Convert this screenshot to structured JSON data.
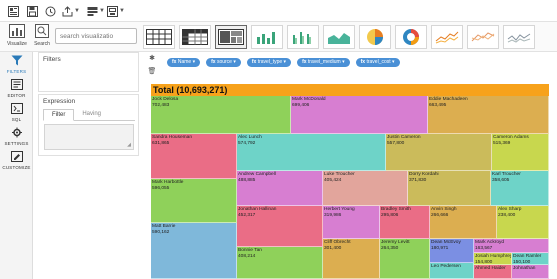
{
  "toolbar": {
    "icons": [
      "dashboard-icon",
      "save-icon",
      "history-icon",
      "export-icon",
      "layout-icon",
      "print-icon"
    ]
  },
  "left_controls": {
    "visualize_label": "Visualize",
    "search_label": "Search",
    "search_placeholder": "search visualizatio"
  },
  "gallery": {
    "items": [
      "table-grid",
      "pivot-table",
      "treemap",
      "bar-chart",
      "grouped-bar-chart",
      "area-chart",
      "pie-chart",
      "donut-chart",
      "line-chart",
      "multi-line-chart",
      "area-line-chart"
    ],
    "active": "treemap"
  },
  "rail": {
    "items": [
      {
        "label": "FILTERS",
        "icon": "filter-icon",
        "active": true
      },
      {
        "label": "EDITOR",
        "icon": "editor-icon",
        "active": false
      },
      {
        "label": "SQL",
        "icon": "sql-icon",
        "active": false
      },
      {
        "label": "SETTINGS",
        "icon": "settings-icon",
        "active": false
      },
      {
        "label": "CUSTOMIZE",
        "icon": "customize-icon",
        "active": false
      }
    ]
  },
  "filters_panel": {
    "title": "Filters"
  },
  "expression_panel": {
    "title": "Expression",
    "tabs": [
      "Filter",
      "Having"
    ],
    "active_tab": "Filter"
  },
  "pills": [
    {
      "prefix": "fx",
      "label": "Name"
    },
    {
      "prefix": "fx",
      "label": "source"
    },
    {
      "prefix": "fx",
      "label": "travel_type"
    },
    {
      "prefix": "fx",
      "label": "travel_medium"
    },
    {
      "prefix": "fx",
      "label": "travel_cost"
    }
  ],
  "treemap": {
    "total_label": "Total (10,693,271)",
    "total_color": "#f7a21b",
    "cells": [
      {
        "name": "Jock Delosa",
        "value": "702,483",
        "color": "#8fd15a"
      },
      {
        "name": "Mark McDonald",
        "value": "699,406",
        "color": "#d77ed1"
      },
      {
        "name": "Eddie Machadeen",
        "value": "663,495",
        "color": "#dcae50"
      },
      {
        "name": "Sandra Houseman",
        "value": "631,865",
        "color": "#ea6d86"
      },
      {
        "name": "Alec Lunch",
        "value": "574,792",
        "color": "#6ed3c8"
      },
      {
        "name": "Justin Cameron",
        "value": "557,800",
        "color": "#cbbb5b"
      },
      {
        "name": "Cameron Adams",
        "value": "515,369",
        "color": "#c8d74e"
      },
      {
        "name": "Mark Harbottle",
        "value": "596,055",
        "color": "#8fd15a"
      },
      {
        "name": "Andrew Campbell",
        "value": "488,885",
        "color": "#d77ed1"
      },
      {
        "name": "Luke Troucher",
        "value": "405,424",
        "color": "#e2a59c"
      },
      {
        "name": "Dorry Kordahi",
        "value": "371,830",
        "color": "#cbbb5b"
      },
      {
        "name": "Karl Troucher",
        "value": "358,605",
        "color": "#6ed3c8"
      },
      {
        "name": "Jonathan Hallinan",
        "value": "452,317",
        "color": "#ea6d86"
      },
      {
        "name": "Herbert Young",
        "value": "319,986",
        "color": "#d77ed1"
      },
      {
        "name": "Bradley Smith",
        "value": "295,806",
        "color": "#ea6d86"
      },
      {
        "name": "Anvin Singh",
        "value": "266,666",
        "color": "#dcae50"
      },
      {
        "name": "Alex Sharp",
        "value": "238,400",
        "color": "#c8d74e"
      },
      {
        "name": "Matt Barrie",
        "value": "590,162",
        "color": "#7fb8da"
      },
      {
        "name": "Bonnie Tan",
        "value": "408,214",
        "color": "#8fd15a"
      },
      {
        "name": "Cliff Obrecht",
        "value": "301,400",
        "color": "#dcae50"
      },
      {
        "name": "Jeremy Levitt",
        "value": "264,350",
        "color": "#8fd15a"
      },
      {
        "name": "Dean McEvoy",
        "value": "180,971",
        "color": "#7b8fe3"
      },
      {
        "name": "Mark Ackroyd",
        "value": "163,567",
        "color": "#d77ed1"
      },
      {
        "name": "Josiah Humphreys",
        "value": "154,800",
        "color": "#c8d74e"
      },
      {
        "name": "Dean Ramler",
        "value": "150,100",
        "color": "#6ed3c8"
      },
      {
        "name": "Leo Pedersen",
        "value": "",
        "color": "#6ed3c8"
      },
      {
        "name": "Ahmed Haider",
        "value": "",
        "color": "#ea6d86"
      },
      {
        "name": "Johnathan",
        "value": "",
        "color": "#d77ed1"
      }
    ]
  }
}
